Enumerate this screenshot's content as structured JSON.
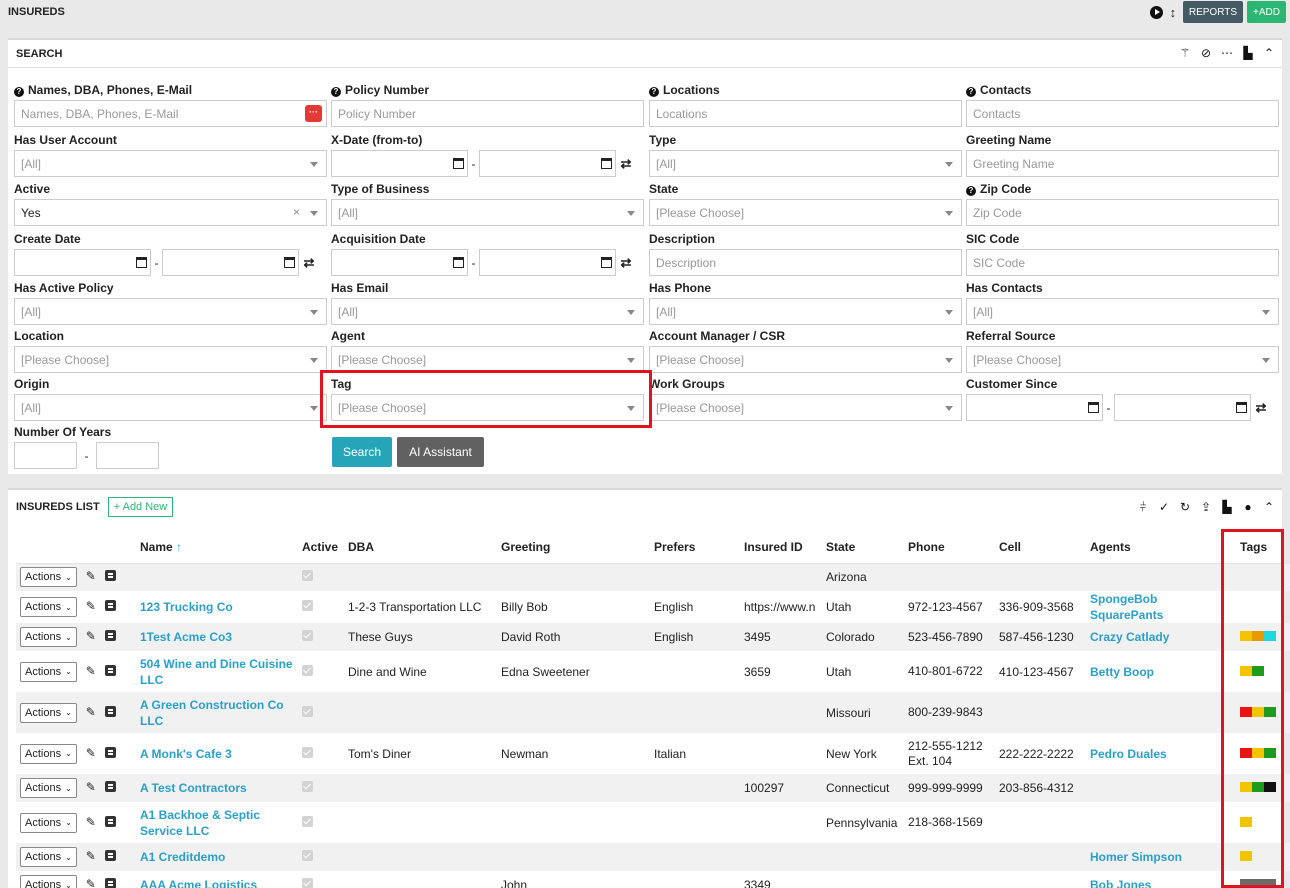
{
  "header": {
    "title": "INSUREDS",
    "reports_label": "REPORTS",
    "add_label": "+ADD"
  },
  "search": {
    "title": "SEARCH",
    "fields": {
      "names": {
        "label": "Names, DBA, Phones, E-Mail",
        "placeholder": "Names, DBA, Phones, E-Mail"
      },
      "policy_number": {
        "label": "Policy Number",
        "placeholder": "Policy Number"
      },
      "locations": {
        "label": "Locations",
        "placeholder": "Locations"
      },
      "contacts": {
        "label": "Contacts",
        "placeholder": "Contacts"
      },
      "has_user_account": {
        "label": "Has User Account",
        "value": "[All]"
      },
      "x_date": {
        "label": "X-Date (from-to)"
      },
      "type": {
        "label": "Type",
        "value": "[All]"
      },
      "greeting_name": {
        "label": "Greeting Name",
        "placeholder": "Greeting Name"
      },
      "active": {
        "label": "Active",
        "value": "Yes"
      },
      "type_of_business": {
        "label": "Type of Business",
        "value": "[All]"
      },
      "state": {
        "label": "State",
        "value": "[Please Choose]"
      },
      "zip_code": {
        "label": "Zip Code",
        "placeholder": "Zip Code"
      },
      "create_date": {
        "label": "Create Date"
      },
      "acquisition_date": {
        "label": "Acquisition Date"
      },
      "description": {
        "label": "Description",
        "placeholder": "Description"
      },
      "sic_code": {
        "label": "SIC Code",
        "placeholder": "SIC Code"
      },
      "has_active_policy": {
        "label": "Has Active Policy",
        "value": "[All]"
      },
      "has_email": {
        "label": "Has Email",
        "value": "[All]"
      },
      "has_phone": {
        "label": "Has Phone",
        "value": "[All]"
      },
      "has_contacts": {
        "label": "Has Contacts",
        "value": "[All]"
      },
      "location": {
        "label": "Location",
        "value": "[Please Choose]"
      },
      "agent": {
        "label": "Agent",
        "value": "[Please Choose]"
      },
      "account_manager": {
        "label": "Account Manager / CSR",
        "value": "[Please Choose]"
      },
      "referral_source": {
        "label": "Referral Source",
        "value": "[Please Choose]"
      },
      "origin": {
        "label": "Origin",
        "value": "[All]"
      },
      "tag": {
        "label": "Tag",
        "value": "[Please Choose]"
      },
      "work_groups": {
        "label": "Work Groups",
        "value": "[Please Choose]"
      },
      "customer_since": {
        "label": "Customer Since"
      },
      "number_of_years": {
        "label": "Number Of Years"
      }
    },
    "search_button": "Search",
    "ai_button": "AI Assistant"
  },
  "list": {
    "title": "INSUREDS LIST",
    "add_new": "+ Add New",
    "columns": [
      "Name",
      "Active",
      "DBA",
      "Greeting",
      "Prefers",
      "Insured ID",
      "State",
      "Phone",
      "Cell",
      "Agents",
      "Tags"
    ],
    "sort_indicator": "↑",
    "actions_label": "Actions",
    "rows": [
      {
        "name": "",
        "dba": "",
        "greeting": "",
        "prefers": "",
        "insured_id": "",
        "state": "Arizona",
        "phone": "",
        "cell": "",
        "agent": "",
        "tags": []
      },
      {
        "name": "123 Trucking Co",
        "dba": "1-2-3 Transportation LLC",
        "greeting": "Billy Bob",
        "prefers": "English",
        "insured_id": "https://www.n",
        "state": "Utah",
        "phone": "972-123-4567",
        "cell": "336-909-3568",
        "agent": "SpongeBob SquarePants",
        "tags": []
      },
      {
        "name": "1Test Acme Co3",
        "dba": "These Guys",
        "greeting": "David Roth",
        "prefers": "English",
        "insured_id": "3495",
        "state": "Colorado",
        "phone": "523-456-7890",
        "cell": "587-456-1230",
        "agent": "Crazy Catlady",
        "tags": [
          "#f5c400",
          "#e59a00",
          "#20d9e0"
        ]
      },
      {
        "name": "504 Wine and Dine Cuisine LLC",
        "dba": "Dine and Wine",
        "greeting": "Edna Sweetener",
        "prefers": "",
        "insured_id": "3659",
        "state": "Utah",
        "phone": "410-801-6722",
        "cell": "410-123-4567",
        "agent": "Betty Boop",
        "tags": [
          "#f5c400",
          "#1e9a1e"
        ]
      },
      {
        "name": "A Green Construction Co LLC",
        "dba": "",
        "greeting": "",
        "prefers": "",
        "insured_id": "",
        "state": "Missouri",
        "phone": "800-239-9843",
        "cell": "",
        "agent": "",
        "tags": [
          "#e81515",
          "#f5c400",
          "#1e9a1e"
        ]
      },
      {
        "name": "A Monk's Cafe 3",
        "dba": "Tom's Diner",
        "greeting": "Newman",
        "prefers": "Italian",
        "insured_id": "",
        "state": "New York",
        "phone": "212-555-1212 Ext. 104",
        "cell": "222-222-2222",
        "agent": "Pedro Duales",
        "tags": [
          "#e81515",
          "#f5c400",
          "#1e9a1e"
        ]
      },
      {
        "name": "A Test Contractors",
        "dba": "",
        "greeting": "",
        "prefers": "",
        "insured_id": "100297",
        "state": "Connecticut",
        "phone": "999-999-9999",
        "cell": "203-856-4312",
        "agent": "",
        "tags": [
          "#f5c400",
          "#1e9a1e",
          "#111111"
        ]
      },
      {
        "name": "A1 Backhoe & Septic Service LLC",
        "dba": "",
        "greeting": "",
        "prefers": "",
        "insured_id": "",
        "state": "Pennsylvania",
        "phone": "218-368-1569",
        "cell": "",
        "agent": "",
        "tags": [
          "#f5c400"
        ]
      },
      {
        "name": "A1 Creditdemo",
        "dba": "",
        "greeting": "",
        "prefers": "",
        "insured_id": "",
        "state": "",
        "phone": "",
        "cell": "",
        "agent": "Homer Simpson",
        "tags": [
          "#f5c400"
        ]
      },
      {
        "name": "AAA Acme Logistics",
        "dba": "",
        "greeting": "John",
        "prefers": "",
        "insured_id": "3349",
        "state": "",
        "phone": "",
        "cell": "",
        "agent": "Bob Jones",
        "tags": [
          "#6b6b6b"
        ]
      }
    ]
  },
  "colors": {
    "accent": "#2a9fc9",
    "teal": "#26a5b8",
    "green": "#2bb673",
    "highlight": "#e0141e"
  }
}
